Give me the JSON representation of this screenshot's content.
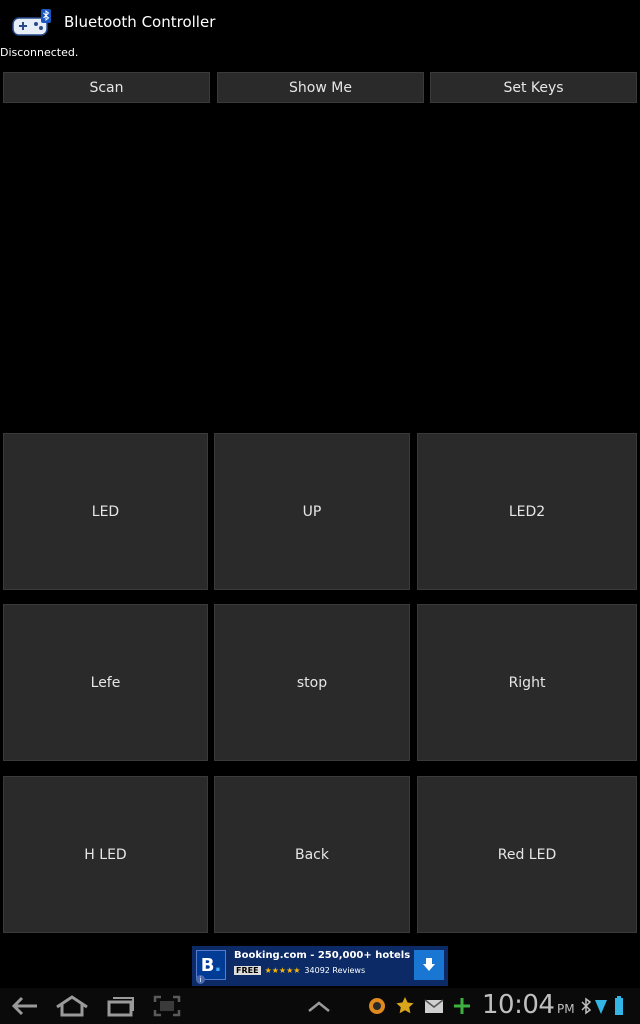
{
  "app": {
    "title": "Bluetooth Controller",
    "status": "Disconnected."
  },
  "top_buttons": [
    {
      "label": "Scan"
    },
    {
      "label": "Show Me"
    },
    {
      "label": "Set Keys"
    }
  ],
  "grid_buttons": [
    {
      "label": "LED"
    },
    {
      "label": "UP"
    },
    {
      "label": "LED2"
    },
    {
      "label": "Lefe"
    },
    {
      "label": "stop"
    },
    {
      "label": "Right"
    },
    {
      "label": "H LED"
    },
    {
      "label": "Back"
    },
    {
      "label": "Red LED"
    }
  ],
  "ad": {
    "logo_letter": "B",
    "title": "Booking.com - 250,000+ hotels",
    "free": "FREE",
    "stars": "★★★★★",
    "reviews": "34092 Reviews",
    "info": "i"
  },
  "system_bar": {
    "time": "10:04",
    "ampm": "PM",
    "icons": [
      "back-icon",
      "home-icon",
      "recent-apps-icon",
      "screenshot-icon",
      "expand-icon",
      "browser-icon",
      "star-icon",
      "mail-icon",
      "plus-icon",
      "bluetooth-icon",
      "wifi-icon",
      "battery-icon"
    ]
  },
  "colors": {
    "background": "#000000",
    "button": "#2a2a2a",
    "button_border": "#3a3a3a",
    "ad_background": "#0b2a66",
    "ad_download": "#1976d2"
  }
}
